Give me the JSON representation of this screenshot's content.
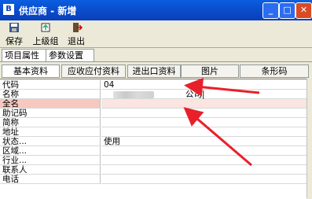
{
  "window": {
    "title": "供应商 - 新增",
    "app_icon_glyph": "B"
  },
  "toolbar": {
    "save_label": "保存",
    "prev_label": "上级组",
    "exit_label": "退出"
  },
  "outer_tabs": [
    "项目属性",
    "参数设置"
  ],
  "inner_tabs": [
    "基本资料",
    "应收应付资料",
    "进出口资料",
    "图片",
    "条形码"
  ],
  "fields": [
    {
      "label": "代码",
      "value": "04"
    },
    {
      "label": "名称",
      "value": "公司|"
    },
    {
      "label": "全名",
      "value": ""
    },
    {
      "label": "助记码",
      "value": ""
    },
    {
      "label": "简称",
      "value": ""
    },
    {
      "label": "地址",
      "value": ""
    },
    {
      "label": "状态...",
      "value": "使用"
    },
    {
      "label": "区域...",
      "value": ""
    },
    {
      "label": "行业...",
      "value": ""
    },
    {
      "label": "联系人",
      "value": ""
    },
    {
      "label": "电话",
      "value": ""
    }
  ],
  "colors": {
    "title_bar": "#0a4fd0",
    "arrow": "#e8202a",
    "highlight_row": "#f7c8c0"
  }
}
